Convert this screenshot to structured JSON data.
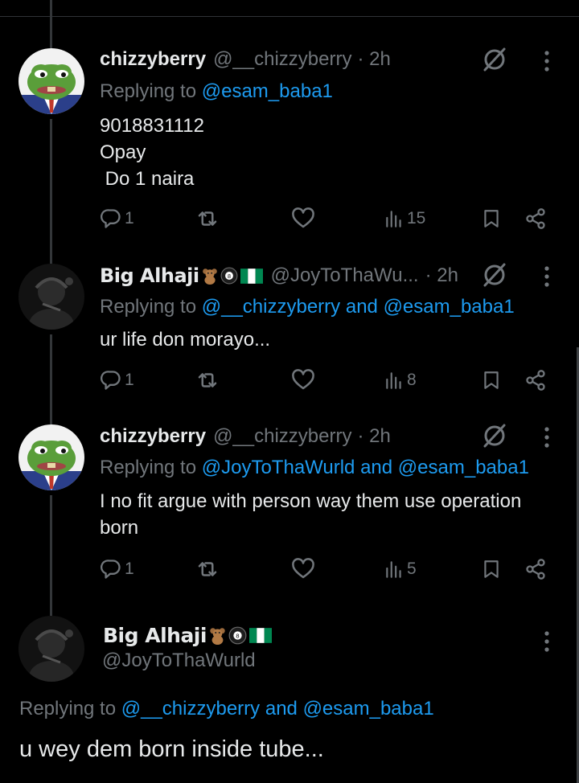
{
  "colors": {
    "background": "#000000",
    "text": "#e7e9ea",
    "muted": "#71767b",
    "link": "#1d9bf0",
    "divider": "#2f3336"
  },
  "replies": [
    {
      "display_name": "chizzyberry",
      "handle": "@__chizzyberry",
      "time": "· 2h",
      "replying_prefix": "Replying to",
      "mention_1": "@esam_baba1",
      "joiner": "",
      "mention_2": "",
      "text": "9018831112\nOpay\n Do 1 naira",
      "reply_count": "1",
      "view_count": "15",
      "avatar_icon": "pepe-frog-avatar",
      "menu_icon": "more-vertical-icon",
      "extra_icon": "grok-icon"
    },
    {
      "display_name": "Big Alhaji",
      "name_emojis": [
        "teddy-bear-emoji",
        "8-ball-emoji",
        "nigeria-flag-emoji"
      ],
      "handle": "@JoyToThaWu...",
      "time": "· 2h",
      "replying_prefix": "Replying to",
      "mention_1": "@__chizzyberry",
      "joiner": "and",
      "mention_2": "@esam_baba1",
      "text": "ur life don morayo...",
      "reply_count": "1",
      "view_count": "8",
      "avatar_icon": "dark-portrait-avatar"
    },
    {
      "display_name": "chizzyberry",
      "handle": "@__chizzyberry",
      "time": "· 2h",
      "replying_prefix": "Replying to",
      "mention_1": "@JoyToThaWurld",
      "joiner": "and",
      "mention_2": "@esam_baba1",
      "text": "I no fit argue with person way them use operation\nborn",
      "reply_count": "1",
      "view_count": "5",
      "avatar_icon": "pepe-frog-avatar"
    }
  ],
  "main_tweet": {
    "display_name": "Big Alhaji",
    "name_emojis": [
      "teddy-bear-emoji",
      "8-ball-emoji",
      "nigeria-flag-emoji"
    ],
    "handle": "@JoyToThaWurld",
    "replying_prefix": "Replying to",
    "mention_1": "@__chizzyberry",
    "joiner": "and",
    "mention_2": "@esam_baba1",
    "text": "u wey dem born inside tube..."
  }
}
